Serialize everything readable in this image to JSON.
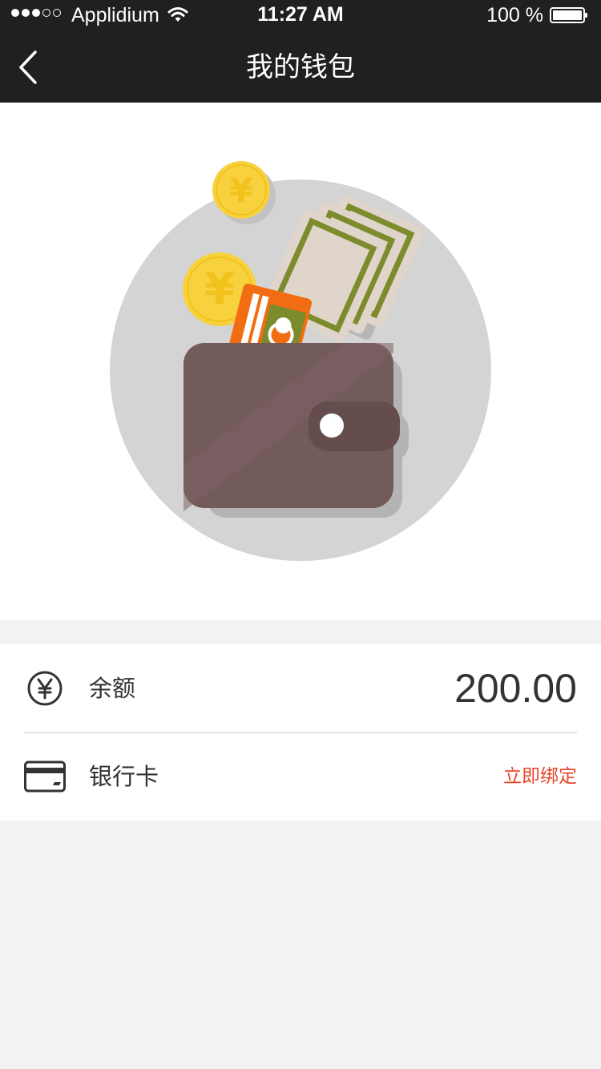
{
  "status_bar": {
    "carrier": "Applidium",
    "time": "11:27 AM",
    "battery": "100 %",
    "signal_bars_filled": 3,
    "signal_bars_total": 5
  },
  "nav": {
    "title": "我的钱包",
    "back_icon": "chevron-left-icon"
  },
  "hero": {
    "illustration": "wallet-icon",
    "coin_symbol": "¥"
  },
  "list": {
    "balance": {
      "icon": "yen-circle-icon",
      "label": "余额",
      "value": "200.00"
    },
    "bank_card": {
      "icon": "bank-card-icon",
      "label": "银行卡",
      "action": "立即绑定"
    }
  },
  "colors": {
    "header_bg": "#221f1f",
    "page_bg": "#f2f2f2",
    "wallet": "#735a5b",
    "coin": "#f7d23e",
    "card": "#f26c12",
    "cash": "#7c8b2c",
    "action_text": "#e8452b"
  }
}
